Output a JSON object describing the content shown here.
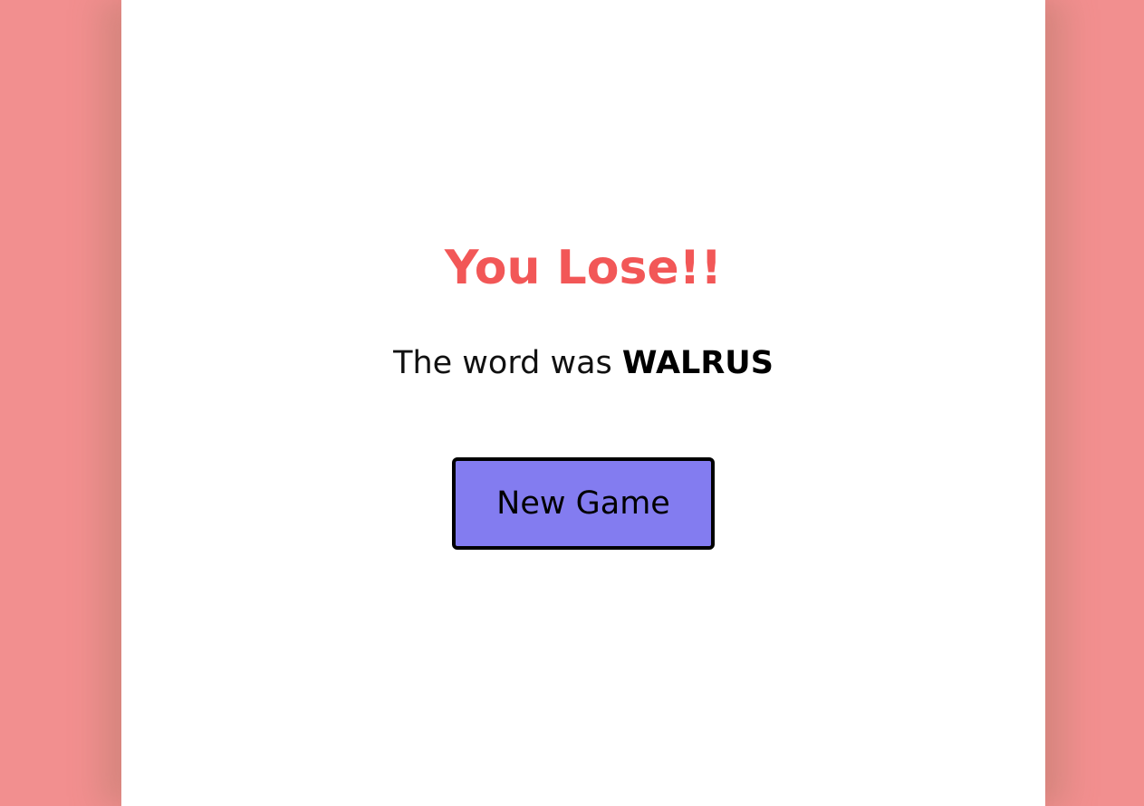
{
  "game": {
    "result_title": "You Lose!!",
    "word_prefix": "The word was",
    "word": "WALRUS",
    "new_game_label": "New Game"
  },
  "colors": {
    "background": "#f28f8f",
    "panel": "#ffffff",
    "result_title": "#f25757",
    "button_fill": "#837cf0",
    "button_border": "#000000"
  }
}
